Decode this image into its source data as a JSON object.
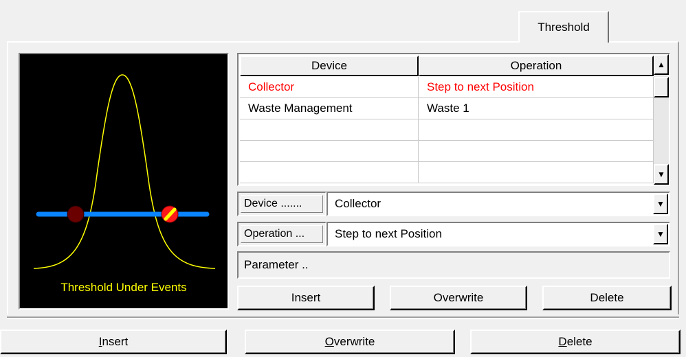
{
  "tab": {
    "label": "Threshold"
  },
  "graphic": {
    "label": "Threshold Under Events",
    "colors": {
      "curve": "#ffff00",
      "line": "#0080ff",
      "marker_left": "#8b0000",
      "marker_right": "#ff0000"
    }
  },
  "table": {
    "columns": [
      "Device",
      "Operation"
    ],
    "rows": [
      {
        "device": "Collector",
        "operation": "Step to next Position",
        "highlight": "#ff0000"
      },
      {
        "device": "Waste Management",
        "operation": "Waste 1"
      },
      {
        "device": "",
        "operation": ""
      },
      {
        "device": "",
        "operation": ""
      },
      {
        "device": "",
        "operation": ""
      }
    ]
  },
  "device": {
    "label": "Device .......",
    "value": "Collector"
  },
  "operation": {
    "label": "Operation ...",
    "value": "Step to next Position"
  },
  "parameter": {
    "label": "Parameter .."
  },
  "inner_buttons": {
    "insert": "Insert",
    "overwrite": "Overwrite",
    "delete": "Delete"
  },
  "bottom_buttons": {
    "insert_accel": "I",
    "insert_rest": "nsert",
    "overwrite_accel": "O",
    "overwrite_rest": "verwrite",
    "delete_accel": "D",
    "delete_rest": "elete"
  }
}
